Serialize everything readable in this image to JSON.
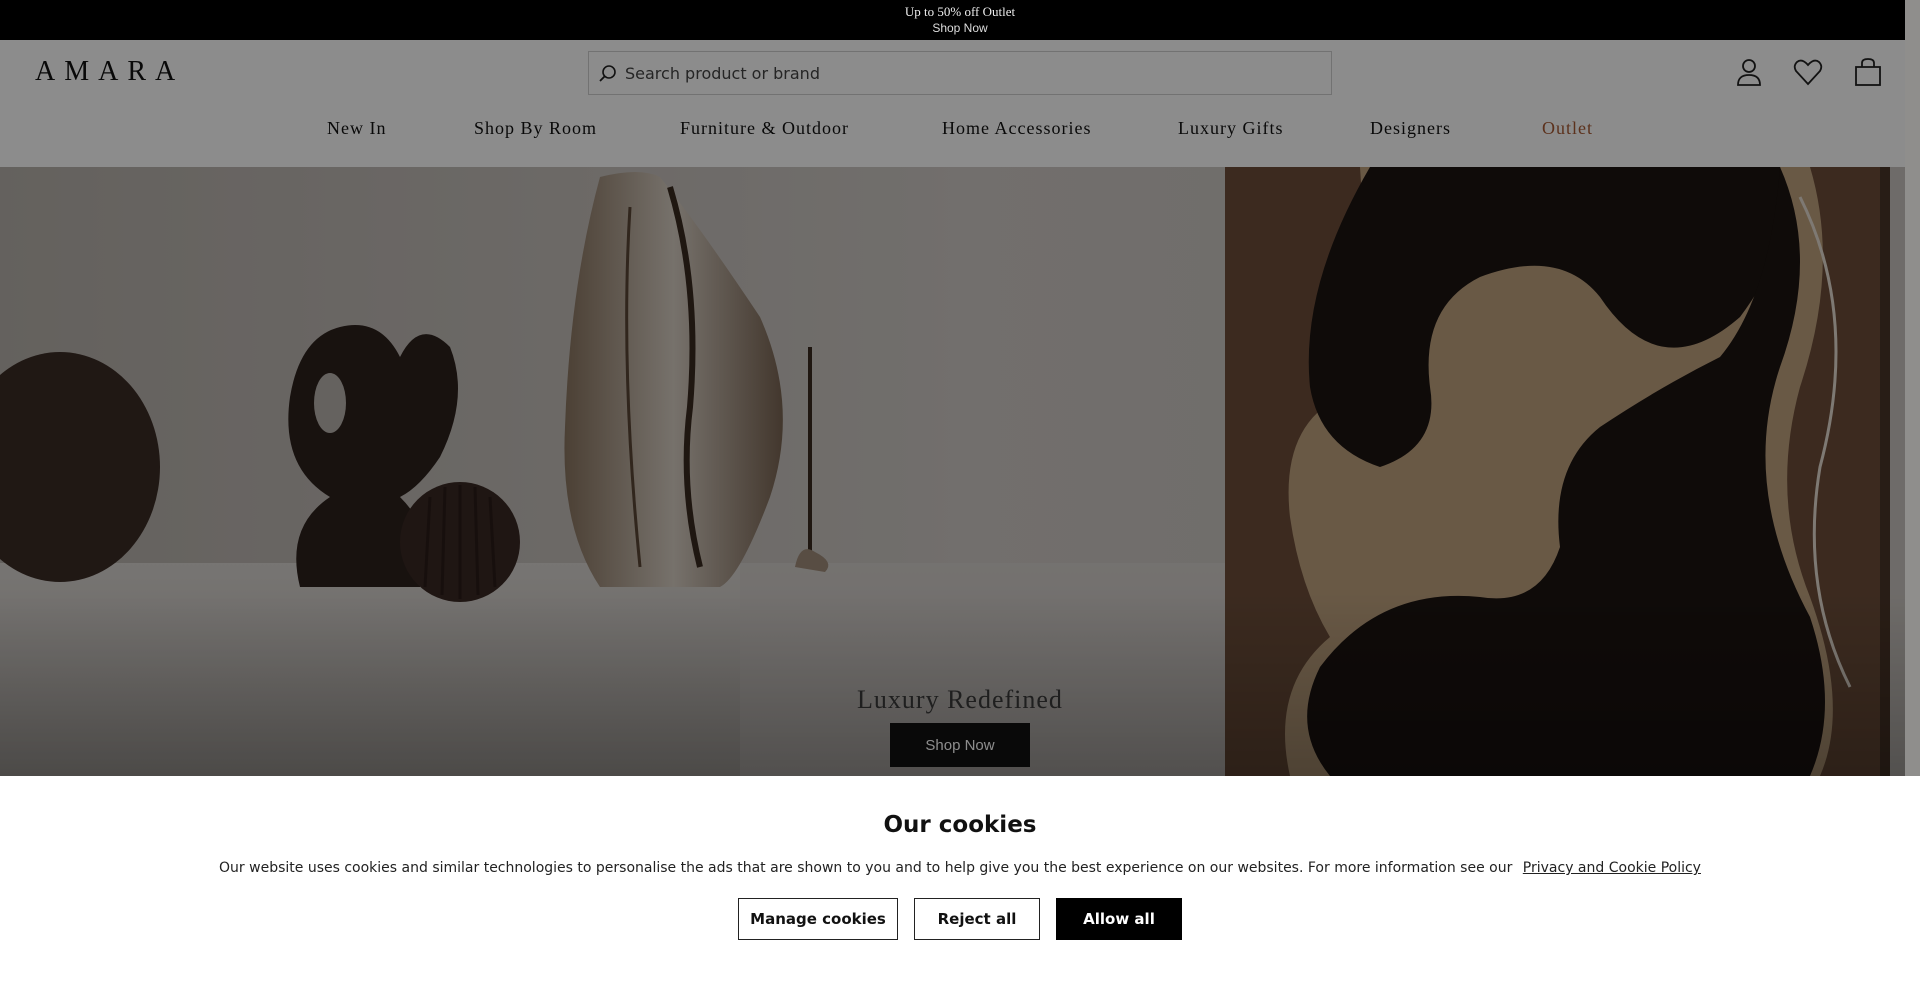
{
  "promo": {
    "line1": "Up to 50% off Outlet",
    "line2": "Shop Now"
  },
  "header": {
    "logo": "AMARA",
    "search": {
      "placeholder": "Search product or brand",
      "value": ""
    },
    "icons": [
      "account-icon",
      "wishlist-heart-icon",
      "shopping-bag-icon"
    ]
  },
  "nav": {
    "items": [
      {
        "label": "New In"
      },
      {
        "label": "Shop By Room"
      },
      {
        "label": "Furniture & Outdoor"
      },
      {
        "label": "Home Accessories"
      },
      {
        "label": "Luxury Gifts"
      },
      {
        "label": "Designers"
      },
      {
        "label": "Outlet"
      }
    ],
    "outlet_color": "#a85a33"
  },
  "hero": {
    "title": "Luxury Redefined",
    "button": "Shop Now"
  },
  "cookie": {
    "title": "Our cookies",
    "message": "Our website uses cookies and similar technologies to personalise the ads that are shown to you and to help give you the best experience on our websites. For more information see our",
    "link": "Privacy and Cookie Policy",
    "buttons": {
      "manage": "Manage cookies",
      "reject": "Reject all",
      "allow": "Allow all"
    }
  }
}
